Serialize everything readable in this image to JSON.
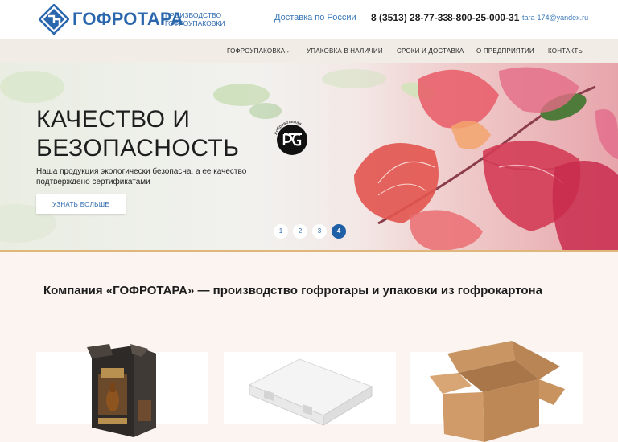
{
  "header": {
    "logo_name": "ГОФРОТАРА",
    "logo_tagline_line1": "ПРОИЗВОДСТВО",
    "logo_tagline_line2": "ГОФРОУПАКОВКИ",
    "delivery": "Доставка по России",
    "phone_primary": "8 (3513) 28-77-33",
    "phone_secondary": "8-800-25-000-31",
    "email": "tara-174@yandex.ru"
  },
  "nav": {
    "items": [
      {
        "label": "ГОФРОУПАКОВКА",
        "has_dropdown": true
      },
      {
        "label": "УПАКОВКА В НАЛИЧИИ"
      },
      {
        "label": "СРОКИ И ДОСТАВКА"
      },
      {
        "label": "О ПРЕДПРИЯТИИ"
      },
      {
        "label": "КОНТАКТЫ"
      }
    ]
  },
  "hero": {
    "title_line1": "КАЧЕСТВО И",
    "title_line2": "БЕЗОПАСНОСТЬ",
    "text": "Наша продукция экологически безопасна, а ее качество подтверждено сертификатами",
    "button_label": "УЗНАТЬ БОЛЬШЕ",
    "badge_text_top": "добровольная",
    "badge_text_bottom": "сертификация",
    "slides": [
      "1",
      "2",
      "3",
      "4"
    ],
    "active_slide": 4
  },
  "main": {
    "title": "Компания «ГОФРОТАРА» — производство гофротары и упаковки из гофрокартона",
    "products": [
      {
        "image": "whisky-gift-box"
      },
      {
        "image": "white-pizza-box"
      },
      {
        "image": "kraft-cardboard-box"
      }
    ]
  },
  "colors": {
    "brand_blue": "#2b67ad",
    "active_dot": "#1e5fa5",
    "accent_rule": "#e0b77a",
    "nav_bg": "#f1ece6",
    "page_bg": "#fbf4f1"
  }
}
